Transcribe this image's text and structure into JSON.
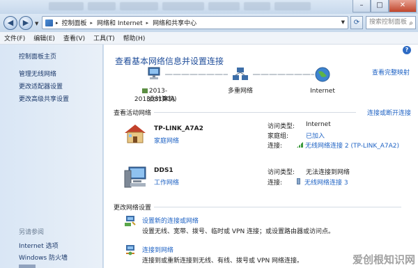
{
  "address_bar": {
    "crumbs": [
      "控制面板",
      "网络和 Internet",
      "网络和共享中心"
    ],
    "search_placeholder": "搜索控制面板"
  },
  "menu": [
    "文件(F)",
    "编辑(E)",
    "查看(V)",
    "工具(T)",
    "帮助(H)"
  ],
  "sidebar": {
    "items": [
      "控制面板主页",
      "管理无线网络",
      "更改适配器设置",
      "更改高级共享设置"
    ],
    "see_also": "另请参阅",
    "see_also_items": [
      "Internet 选项",
      "Windows 防火墙"
    ]
  },
  "main": {
    "heading": "查看基本网络信息并设置连接",
    "view_full_map": "查看完整映射",
    "map": {
      "pc_name": "2013-20130819CA",
      "pc_sub": "(此计算机)",
      "middle": "多重网络",
      "internet": "Internet"
    },
    "active_header": "查看活动网络",
    "connect_link": "连接或断开连接",
    "networks": [
      {
        "name": "TP-LINK_A7A2",
        "type": "家庭网络",
        "k1": "访问类型:",
        "v1": "Internet",
        "k2": "家庭组:",
        "v2": "已加入",
        "k3": "连接:",
        "v3": "无线网络连接 2 (TP-LINK_A7A2)"
      },
      {
        "name": "DDS1",
        "type": "工作网络",
        "k1": "访问类型:",
        "v1": "无法连接到网络",
        "k2": "连接:",
        "v2": "无线网络连接 3"
      }
    ],
    "change_header": "更改网络设置",
    "tasks": [
      {
        "title": "设置新的连接或网络",
        "desc": "设置无线、宽带、拨号、临时或 VPN 连接；或设置路由器或访问点。"
      },
      {
        "title": "连接到网络",
        "desc": "连接到或重新连接到无线、有线、拨号或 VPN 网络连接。"
      }
    ]
  },
  "watermark": "爱创根知识网",
  "colors": {
    "link": "#1f63c4",
    "heading": "#1f4d9a",
    "sidebar_bg": "#dde8f5"
  }
}
